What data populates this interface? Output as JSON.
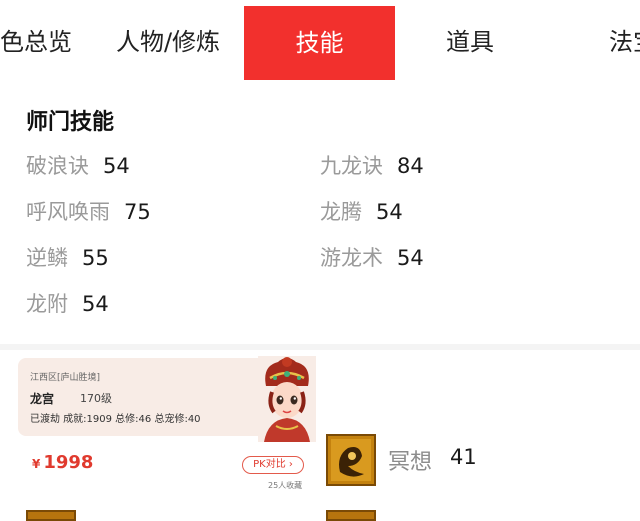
{
  "tabs": [
    {
      "label": "色总览"
    },
    {
      "label": "人物/修炼"
    },
    {
      "label": "技能",
      "active": true
    },
    {
      "label": "道具"
    },
    {
      "label": "法宝"
    }
  ],
  "skills_section": {
    "title": "师门技能",
    "skills": [
      {
        "name": "破浪诀",
        "level": "54"
      },
      {
        "name": "九龙诀",
        "level": "84"
      },
      {
        "name": "呼风唤雨",
        "level": "75"
      },
      {
        "name": "龙腾",
        "level": "54"
      },
      {
        "name": "逆鳞",
        "level": "55"
      },
      {
        "name": "游龙术",
        "level": "54"
      },
      {
        "name": "龙附",
        "level": "54"
      }
    ]
  },
  "listing_card": {
    "server": "江西区[庐山胜境]",
    "sect": "龙宫",
    "level": "170级",
    "stats": "已渡劫 成就:1909 总修:46 总宠修:40",
    "currency": "¥",
    "price": "1998",
    "pk_button": "PK对比 ›",
    "favorites": "25人收藏"
  },
  "meditate_skill": {
    "name": "冥想",
    "level": "41"
  },
  "colors": {
    "accent": "#f2302d",
    "price": "#e03a2e",
    "muted": "#9a9a9a"
  },
  "icons": [
    "pk-chevron-icon",
    "meditate-skill-icon",
    "character-avatar-icon"
  ]
}
